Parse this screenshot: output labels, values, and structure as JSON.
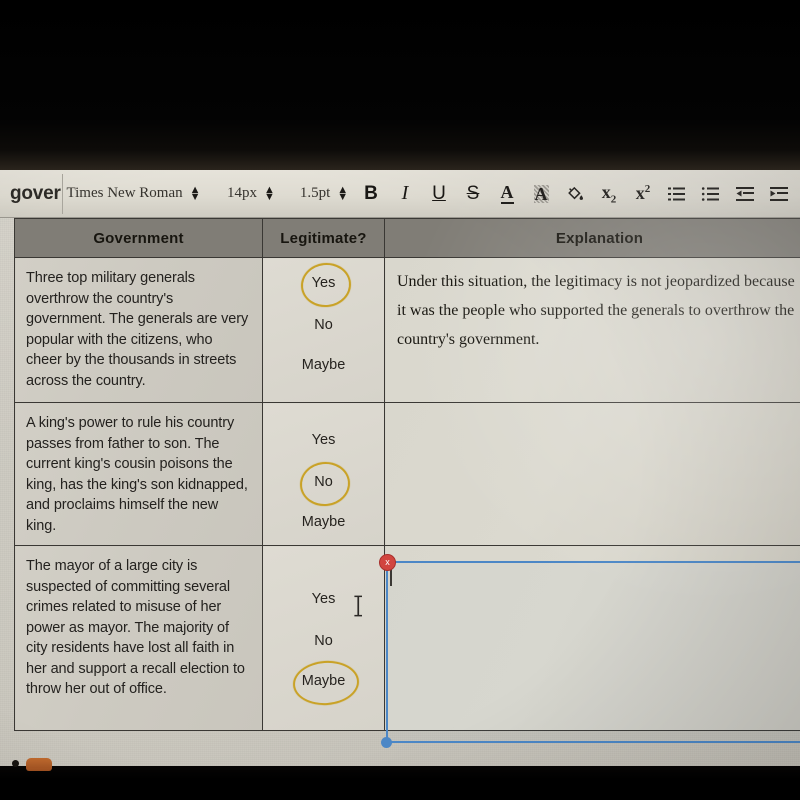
{
  "toolbar": {
    "leftover_text": "gover",
    "font_family_value": "Times New Roman",
    "font_size_value": "14px",
    "line_height_value": "1.5pt",
    "bold_label": "B",
    "italic_label": "I",
    "underline_label": "U",
    "strikethrough_label": "S",
    "text_color_label": "A",
    "highlight_label": "A",
    "fill_color_icon": "paint-bucket-icon",
    "subscript_label": "x",
    "subscript_index": "2",
    "superscript_label": "x",
    "superscript_index": "2",
    "numbered_list_icon": "numbered-list-icon",
    "bulleted_list_icon": "bulleted-list-icon",
    "decrease_indent_icon": "decrease-indent-icon",
    "increase_indent_icon": "increase-indent-icon"
  },
  "table": {
    "headers": [
      "Government",
      "Legitimate?",
      "Explanation"
    ],
    "options": [
      "Yes",
      "No",
      "Maybe"
    ],
    "rows": [
      {
        "government": "Three top military generals overthrow the country's government. The generals are very popular with the citizens, who cheer by the thousands in streets across the country.",
        "selected_option": "Yes",
        "explanation": "Under this situation, the legitimacy is not jeopardized because it was the people who supported the generals to overthrow the country's government."
      },
      {
        "government": "A king's power to rule his country passes from father to son. The current king's cousin poisons the king, has the king's son kidnapped, and proclaims himself the new king.",
        "selected_option": "No",
        "explanation": ""
      },
      {
        "government": "The mayor of a large city is suspected of committing several crimes related to misuse of her power as mayor. The majority of city residents have lost all faith in her and support a recall election to throw her out of office.",
        "selected_option": "Maybe",
        "explanation": ""
      }
    ]
  },
  "colors": {
    "circle_highlight": "#c9a227",
    "selection_border": "#4c87c6",
    "selection_handle_delete": "#d1453f",
    "selection_handle_resize": "#4c87c6",
    "header_background": "#807d76",
    "page_background": "#d2cfc6"
  },
  "selection": {
    "active_cell": "row-3-explanation",
    "delete_handle_label": "x"
  }
}
